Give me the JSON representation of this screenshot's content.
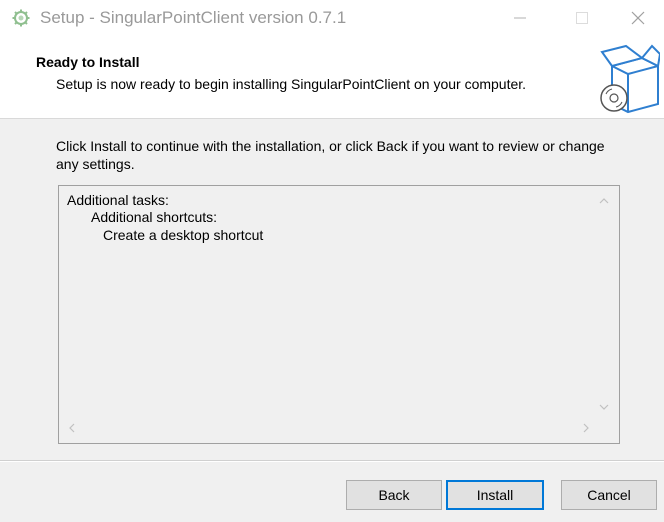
{
  "window": {
    "title": "Setup - SingularPointClient version 0.7.1"
  },
  "header": {
    "title": "Ready to Install",
    "subtitle": "Setup is now ready to begin installing SingularPointClient on your computer."
  },
  "body": {
    "instruction": "Click Install to continue with the installation, or click Back if you want to review or change any settings.",
    "memo_lines": [
      "Additional tasks:",
      "Additional shortcuts:",
      "Create a desktop shortcut"
    ]
  },
  "buttons": {
    "back": "Back",
    "install": "Install",
    "cancel": "Cancel"
  },
  "icons": {
    "app": "gear-setup-icon",
    "header": "software-box-cd-icon",
    "minimize": "minimize-icon",
    "maximize": "maximize-icon",
    "close": "close-icon"
  },
  "colors": {
    "accent": "#0078d7",
    "title_text": "#999999"
  }
}
